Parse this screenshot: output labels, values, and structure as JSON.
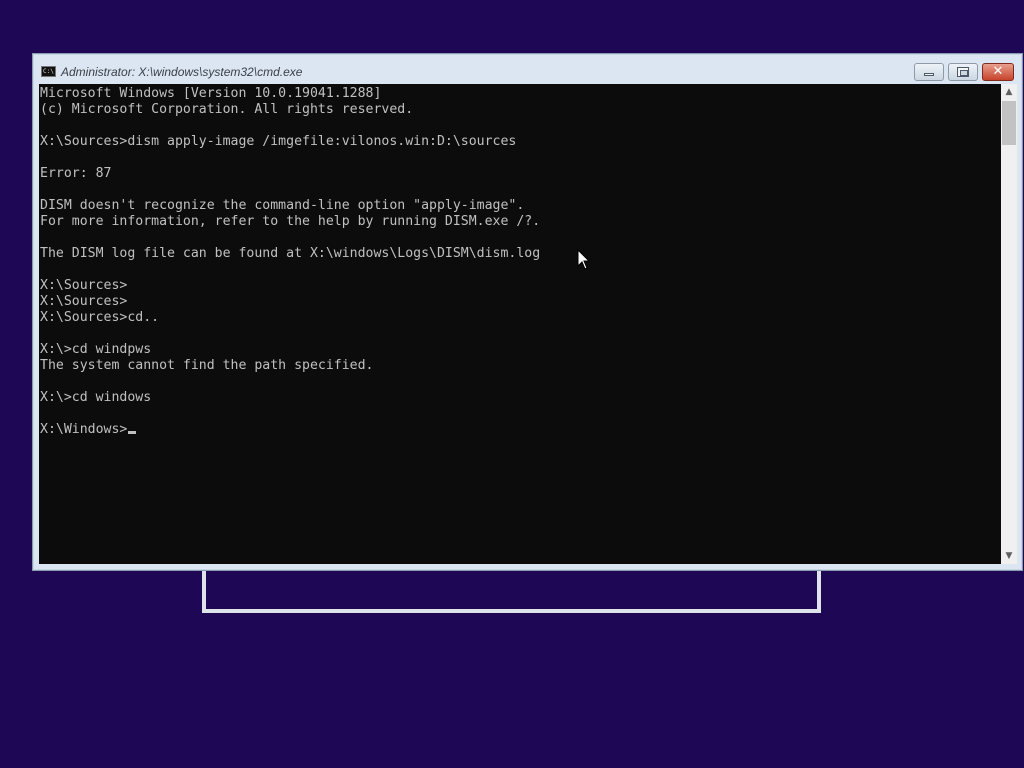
{
  "window": {
    "title": "Administrator: X:\\windows\\system32\\cmd.exe",
    "icon_text": "C:\\"
  },
  "caption_buttons": {
    "close_glyph": "✕"
  },
  "console": {
    "lines": [
      "Microsoft Windows [Version 10.0.19041.1288]",
      "(c) Microsoft Corporation. All rights reserved.",
      "",
      "X:\\Sources>dism apply-image /imgefile:vilonos.win:D:\\sources",
      "",
      "Error: 87",
      "",
      "DISM doesn't recognize the command-line option \"apply-image\".",
      "For more information, refer to the help by running DISM.exe /?.",
      "",
      "The DISM log file can be found at X:\\windows\\Logs\\DISM\\dism.log",
      "",
      "X:\\Sources>",
      "X:\\Sources>",
      "X:\\Sources>cd..",
      "",
      "X:\\>cd windpws",
      "The system cannot find the path specified.",
      "",
      "X:\\>cd windows",
      "",
      "X:\\Windows>"
    ],
    "text_color": "#c0c0c0",
    "background_color": "#0c0c0c"
  },
  "scrollbar": {
    "up_glyph": "▲",
    "down_glyph": "▼"
  },
  "desktop": {
    "background_color": "#1e0754"
  },
  "icons": {
    "app_icon": "cmd-icon",
    "pointer": "mouse-pointer-icon"
  }
}
